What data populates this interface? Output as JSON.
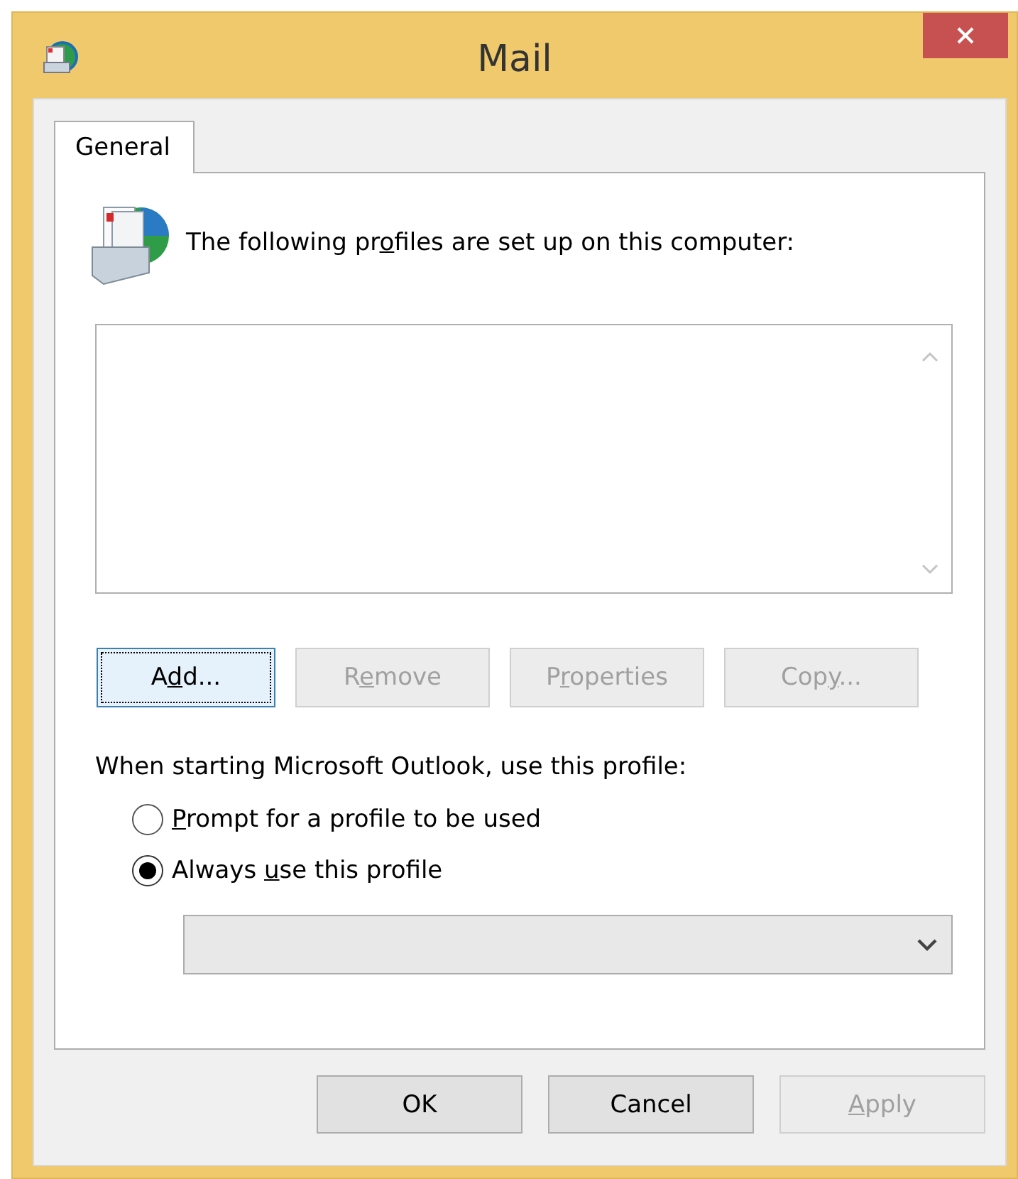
{
  "window": {
    "title": "Mail"
  },
  "tabs": [
    {
      "label": "General",
      "selected": true
    }
  ],
  "intro": {
    "before": "The following pr",
    "key": "o",
    "after": "files are set up on this computer:"
  },
  "profile_list": {
    "disabled": true
  },
  "profile_buttons": [
    {
      "before": "A",
      "key": "d",
      "after": "d...",
      "disabled": false,
      "focused": true
    },
    {
      "before": "R",
      "key": "e",
      "after": "move",
      "disabled": true,
      "focused": false
    },
    {
      "before": "P",
      "key": "r",
      "after": "operties",
      "disabled": true,
      "focused": false
    },
    {
      "before": "Cop",
      "key": "y",
      "after": "...",
      "disabled": true,
      "focused": false
    }
  ],
  "startup_label": "When starting Microsoft Outlook, use this profile:",
  "startup_options": [
    {
      "key": "P",
      "after": "rompt for a profile to be used",
      "selected": false
    },
    {
      "before": "Always ",
      "key": "u",
      "after": "se this profile",
      "selected": true
    }
  ],
  "profile_dropdown": {
    "disabled": true
  },
  "dialog_buttons": [
    {
      "after": "OK",
      "disabled": false
    },
    {
      "after": "Cancel",
      "disabled": false
    },
    {
      "key": "A",
      "after": "pply",
      "disabled": true
    }
  ]
}
